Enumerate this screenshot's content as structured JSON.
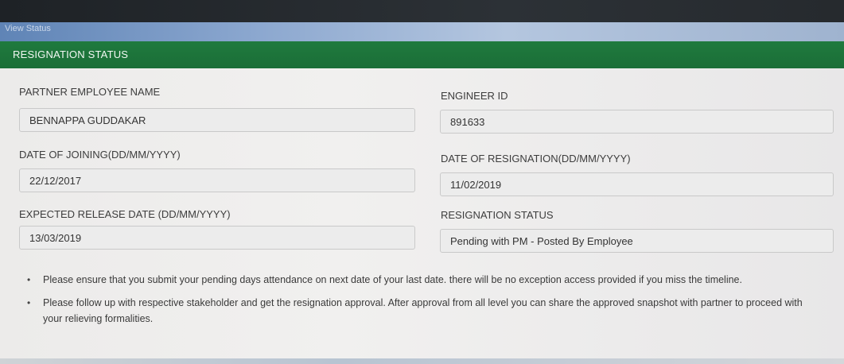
{
  "breadcrumb": {
    "label": "View Status"
  },
  "panel": {
    "title": "RESIGNATION STATUS"
  },
  "fields": {
    "partner_employee_name": {
      "label": "PARTNER EMPLOYEE NAME",
      "value": "BENNAPPA GUDDAKAR"
    },
    "engineer_id": {
      "label": "ENGINEER ID",
      "value": "891633"
    },
    "date_of_joining": {
      "label": "DATE OF JOINING(DD/MM/YYYY)",
      "value": "22/12/2017"
    },
    "date_of_resignation": {
      "label": "DATE OF RESIGNATION(DD/MM/YYYY)",
      "value": "11/02/2019"
    },
    "expected_release_date": {
      "label": "EXPECTED RELEASE DATE (DD/MM/YYYY)",
      "value": "13/03/2019"
    },
    "resignation_status": {
      "label": "RESIGNATION STATUS",
      "value": "Pending with PM - Posted By Employee"
    }
  },
  "notes": [
    "Please ensure that you submit your pending days attendance on next date of your last date. there will be no exception access provided if you miss the timeline.",
    "Please follow up with respective stakeholder and get the resignation approval. After approval from all level you can share the approved snapshot with partner to proceed with your relieving formalities."
  ],
  "colors": {
    "header_green": "#1f7a3e",
    "breadcrumb_blue": "#8ba7cf",
    "field_bg": "#ececec"
  }
}
